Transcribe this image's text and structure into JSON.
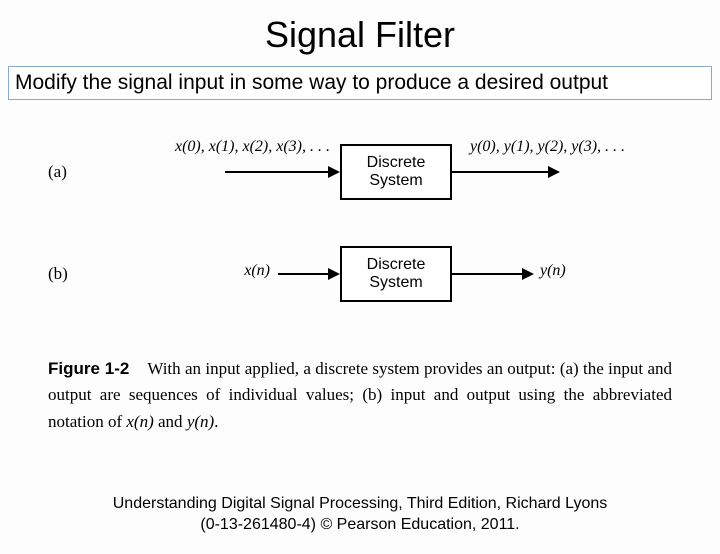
{
  "title": "Signal Filter",
  "subtitle": "Modify the signal input in some way to produce a desired output",
  "diagram": {
    "row_a": {
      "label": "(a)",
      "input": "x(0), x(1), x(2), x(3), . . .",
      "box": "Discrete System",
      "output": "y(0), y(1), y(2), y(3), . . ."
    },
    "row_b": {
      "label": "(b)",
      "input": "x(n)",
      "box": "Discrete System",
      "output": "y(n)"
    }
  },
  "caption": {
    "fig_num": "Figure 1-2",
    "text_1": "With an input applied, a discrete system provides an output: (a) the input and output are sequences of individual values; (b) input and output using the abbreviated notation of ",
    "xn": "x(n)",
    "and": " and ",
    "yn": "y(n)",
    "period": "."
  },
  "footer": {
    "line1": "Understanding Digital Signal Processing, Third Edition, Richard Lyons",
    "line2": "(0-13-261480-4) © Pearson Education, 2011."
  }
}
